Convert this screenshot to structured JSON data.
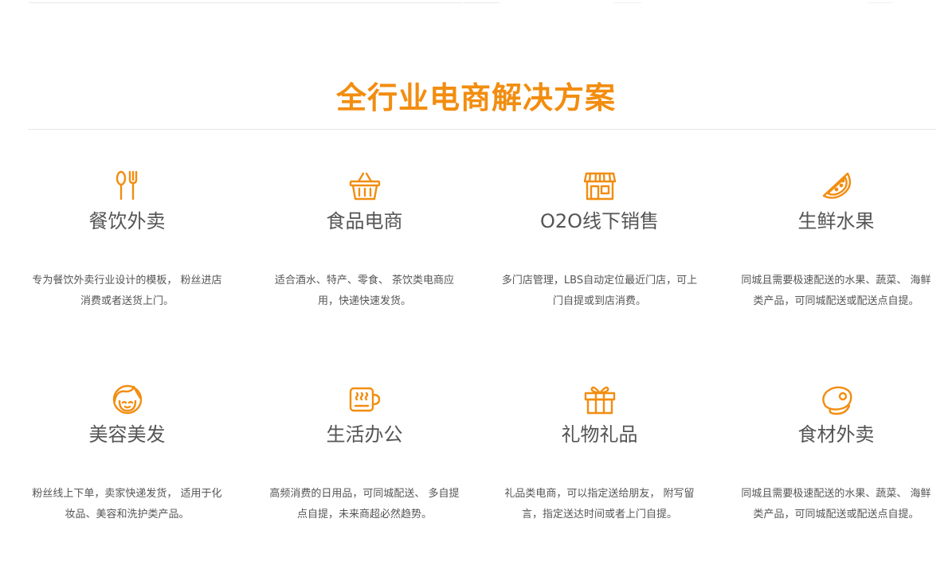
{
  "section_title": "全行业电商解决方案",
  "accent_color": "#f28d10",
  "cards": [
    {
      "icon": "fork-spoon-icon",
      "title": "餐饮外卖",
      "desc": "专为餐饮外卖行业设计的模板， 粉丝进店消费或者送货上门。"
    },
    {
      "icon": "shopping-basket-icon",
      "title": "食品电商",
      "desc": "适合酒水、特产、零食、 茶饮类电商应用，快递快速发货。"
    },
    {
      "icon": "storefront-icon",
      "title": "O2O线下销售",
      "desc": "多门店管理，LBS自动定位最近门店，可上门自提或到店消费。"
    },
    {
      "icon": "watermelon-slice-icon",
      "title": "生鲜水果",
      "desc": "同城且需要极速配送的水果、蔬菜、 海鲜类产品，可同城配送或配送点自提。"
    },
    {
      "icon": "woman-face-icon",
      "title": "美容美发",
      "desc": "粉丝线上下单，卖家快递发货， 适用于化妆品、美容和洗护类产品。"
    },
    {
      "icon": "coffee-cup-icon",
      "title": "生活办公",
      "desc": "高频消费的日用品，可同城配送、 多自提点自提，未来商超必然趋势。"
    },
    {
      "icon": "gift-box-icon",
      "title": "礼物礼品",
      "desc": "礼品类电商，可以指定送给朋友， 附写留言，指定送达时间或者上门自提。"
    },
    {
      "icon": "meat-steak-icon",
      "title": "食材外卖",
      "desc": "同城且需要极速配送的水果、蔬菜、 海鲜类产品，可同城配送或配送点自提。"
    }
  ]
}
